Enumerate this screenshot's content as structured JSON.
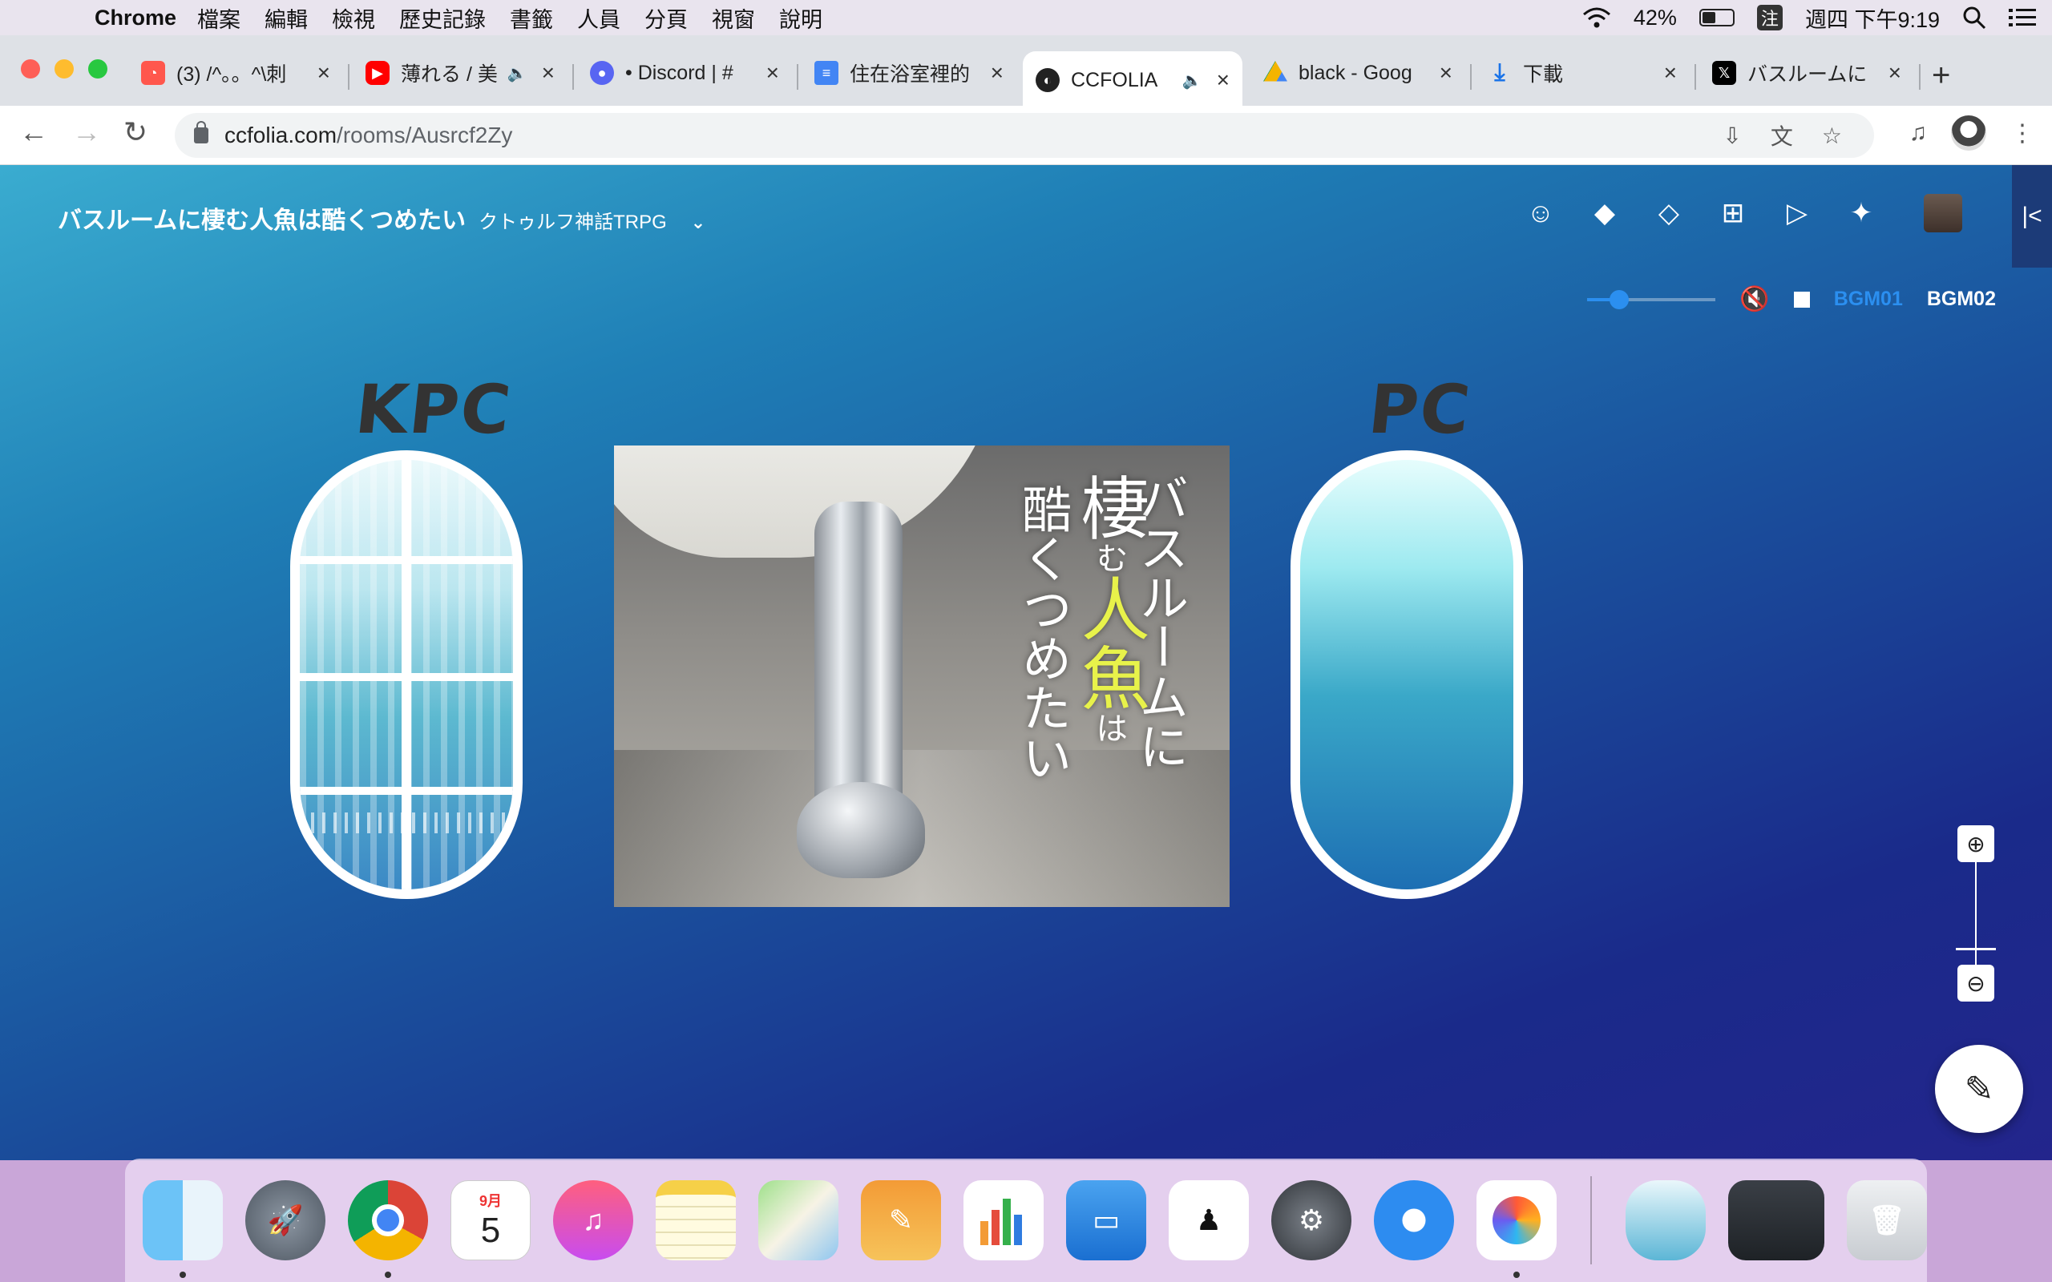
{
  "menubar": {
    "app": "Chrome",
    "items": [
      "檔案",
      "編輯",
      "檢視",
      "歷史記錄",
      "書籤",
      "人員",
      "分頁",
      "視窗",
      "說明"
    ],
    "battery": "42%",
    "ime": "注",
    "clock": "週四 下午9:19"
  },
  "tabs": [
    {
      "title": "(3) /^。。^\\刺",
      "favicon": "plurk-icon"
    },
    {
      "title": "薄れる / 美",
      "favicon": "youtube-icon"
    },
    {
      "title": "• Discord | #",
      "favicon": "discord-icon"
    },
    {
      "title": "住在浴室裡的",
      "favicon": "docs-icon"
    },
    {
      "title": "CCFOLIA",
      "favicon": "ccfolia-icon"
    },
    {
      "title": "black - Goog",
      "favicon": "drive-icon"
    },
    {
      "title": "下載",
      "favicon": "download-icon"
    },
    {
      "title": "バスルームに",
      "favicon": "x-icon"
    }
  ],
  "address": {
    "host": "ccfolia.com",
    "path": "/rooms/Ausrcf2Zy"
  },
  "room": {
    "title": "バスルームに棲む人魚は酷くつめたい",
    "system": "クトゥルフ神話TRPG",
    "bgm_tabs": [
      "BGM01",
      "BGM02"
    ],
    "volume": 0.25,
    "kpc_label": "KPC",
    "pc_label": "PC",
    "cover": {
      "line1": "バスルームに",
      "line2_a": "棲",
      "line2_b": "む",
      "line2_c": "人魚",
      "line2_d": "は",
      "line3": "酷くつめたい"
    }
  },
  "colors": {
    "accent_bgm": "#2b8ff0",
    "cover_accent": "#e8f24a"
  },
  "dock": [
    {
      "name": "finder-icon",
      "running": true
    },
    {
      "name": "launchpad-icon",
      "running": false
    },
    {
      "name": "chrome-icon",
      "running": true
    },
    {
      "name": "calendar-icon",
      "running": false,
      "month": "9月",
      "day": "5"
    },
    {
      "name": "music-icon",
      "running": false
    },
    {
      "name": "notes-icon",
      "running": false
    },
    {
      "name": "maps-icon",
      "running": false
    },
    {
      "name": "pages-icon",
      "running": false
    },
    {
      "name": "numbers-icon",
      "running": false
    },
    {
      "name": "keynote-icon",
      "running": false
    },
    {
      "name": "medibang-icon",
      "running": false
    },
    {
      "name": "system-preferences-icon",
      "running": false
    },
    {
      "name": "safari-icon",
      "running": false
    },
    {
      "name": "paint-app-icon",
      "running": true
    }
  ]
}
